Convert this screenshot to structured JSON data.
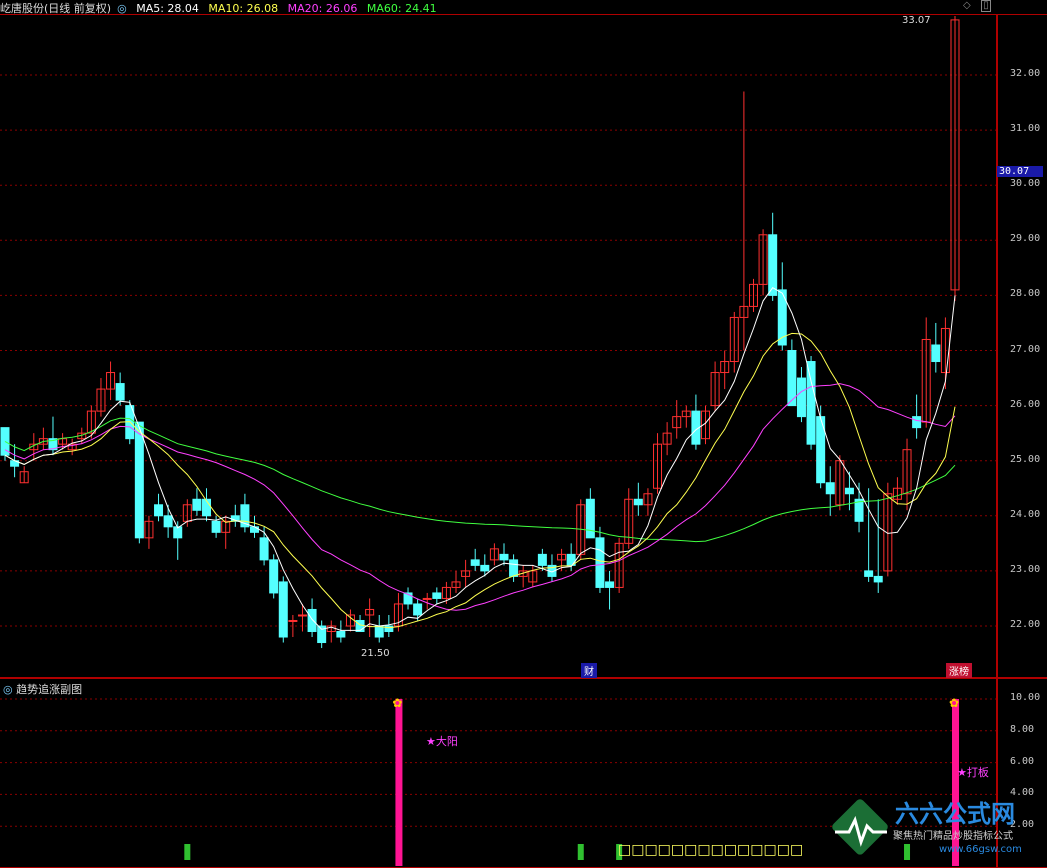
{
  "header": {
    "stock": "屹唐股份(日线 前复权)",
    "ma5": "MA5: 28.04",
    "ma10": "MA10: 26.08",
    "ma20": "MA20: 26.06",
    "ma60": "MA60: 24.41"
  },
  "price_axis": {
    "labels": [
      "32.00",
      "31.00",
      "30.00",
      "29.00",
      "28.00",
      "27.00",
      "26.00",
      "25.00",
      "24.00",
      "23.00",
      "22.00"
    ],
    "current_price": "30.07"
  },
  "annotations": {
    "high": "33.07",
    "low": "21.50",
    "cai_tag": "财",
    "zhangbang_tag": "涨榜"
  },
  "subchart": {
    "title": "趋势追涨副图",
    "axis_labels": [
      "10.00",
      "8.00",
      "6.00",
      "4.00",
      "2.00"
    ],
    "signal1": "★大阳",
    "signal2": "★打板",
    "bottom_squares": "□□□□□□□□□□□□□□"
  },
  "watermark": {
    "brand": "六六公式网",
    "slogan": "聚焦热门精品炒股指标公式",
    "url": "www.66gsw.com"
  },
  "colors": {
    "up": "#ff3030",
    "down": "#54ffff",
    "ma5": "#ffffff",
    "ma10": "#ffff50",
    "ma20": "#ff40ff",
    "ma60": "#40ff40",
    "signal_bar": "#ff1493",
    "grid": "#8b0000"
  },
  "chart_data": [
    {
      "type": "candlestick",
      "title": "屹唐股份(日线 前复权)",
      "ylim": [
        21.3,
        33.3
      ],
      "series": [
        {
          "name": "MA5",
          "value_last": 28.04
        },
        {
          "name": "MA10",
          "value_last": 26.08
        },
        {
          "name": "MA20",
          "value_last": 26.06
        },
        {
          "name": "MA60",
          "value_last": 24.41
        }
      ],
      "candles_ohlc": [
        [
          25.6,
          25.6,
          25.0,
          25.1
        ],
        [
          25.0,
          25.3,
          24.7,
          24.9
        ],
        [
          24.6,
          24.9,
          24.6,
          24.8
        ],
        [
          25.2,
          25.5,
          25.0,
          25.3
        ],
        [
          25.3,
          25.6,
          25.2,
          25.4
        ],
        [
          25.4,
          25.8,
          25.1,
          25.2
        ],
        [
          25.3,
          25.5,
          25.2,
          25.4
        ],
        [
          25.2,
          25.4,
          25.1,
          25.3
        ],
        [
          25.4,
          25.6,
          25.3,
          25.5
        ],
        [
          25.5,
          26.0,
          25.4,
          25.9
        ],
        [
          25.9,
          26.5,
          25.8,
          26.3
        ],
        [
          26.3,
          26.8,
          26.1,
          26.6
        ],
        [
          26.4,
          26.6,
          26.0,
          26.1
        ],
        [
          26.0,
          26.1,
          25.3,
          25.4
        ],
        [
          25.7,
          25.7,
          23.5,
          23.6
        ],
        [
          23.6,
          24.0,
          23.4,
          23.9
        ],
        [
          24.2,
          24.4,
          23.9,
          24.0
        ],
        [
          24.0,
          24.2,
          23.6,
          23.8
        ],
        [
          23.8,
          23.9,
          23.2,
          23.6
        ],
        [
          23.9,
          24.3,
          23.8,
          24.2
        ],
        [
          24.3,
          24.5,
          24.0,
          24.1
        ],
        [
          24.3,
          24.5,
          23.9,
          24.0
        ],
        [
          23.9,
          24.0,
          23.6,
          23.7
        ],
        [
          23.7,
          24.0,
          23.4,
          23.9
        ],
        [
          24.0,
          24.2,
          23.8,
          23.9
        ],
        [
          24.2,
          24.4,
          23.7,
          23.8
        ],
        [
          23.8,
          24.0,
          23.6,
          23.7
        ],
        [
          23.6,
          23.8,
          23.1,
          23.2
        ],
        [
          23.2,
          23.3,
          22.5,
          22.6
        ],
        [
          22.8,
          22.9,
          21.7,
          21.8
        ],
        [
          22.1,
          22.2,
          21.8,
          22.1
        ],
        [
          22.2,
          22.4,
          21.9,
          22.2
        ],
        [
          22.3,
          22.5,
          21.8,
          21.9
        ],
        [
          22.0,
          22.1,
          21.6,
          21.7
        ],
        [
          21.9,
          22.1,
          21.7,
          22.0
        ],
        [
          21.9,
          22.1,
          21.7,
          21.8
        ],
        [
          22.0,
          22.3,
          21.9,
          22.2
        ],
        [
          22.1,
          22.2,
          21.9,
          21.9
        ],
        [
          22.2,
          22.5,
          21.8,
          22.3
        ],
        [
          22.0,
          22.2,
          21.7,
          21.8
        ],
        [
          22.0,
          22.2,
          21.8,
          21.9
        ],
        [
          22.0,
          22.6,
          21.9,
          22.4
        ],
        [
          22.6,
          22.7,
          22.3,
          22.4
        ],
        [
          22.4,
          22.5,
          22.1,
          22.2
        ],
        [
          22.5,
          22.6,
          22.3,
          22.5
        ],
        [
          22.6,
          22.7,
          22.4,
          22.5
        ],
        [
          22.5,
          22.8,
          22.4,
          22.7
        ],
        [
          22.7,
          23.0,
          22.6,
          22.8
        ],
        [
          22.9,
          23.2,
          22.7,
          23.0
        ],
        [
          23.2,
          23.4,
          23.0,
          23.1
        ],
        [
          23.1,
          23.3,
          22.9,
          23.0
        ],
        [
          23.2,
          23.5,
          23.1,
          23.4
        ],
        [
          23.3,
          23.5,
          23.1,
          23.2
        ],
        [
          23.2,
          23.3,
          22.8,
          22.9
        ],
        [
          22.9,
          23.1,
          22.7,
          23.0
        ],
        [
          22.8,
          23.1,
          22.7,
          23.0
        ],
        [
          23.3,
          23.4,
          23.0,
          23.1
        ],
        [
          23.1,
          23.3,
          22.8,
          22.9
        ],
        [
          23.2,
          23.4,
          23.0,
          23.3
        ],
        [
          23.3,
          23.5,
          23.0,
          23.1
        ],
        [
          23.3,
          24.3,
          23.2,
          24.2
        ],
        [
          24.3,
          24.5,
          23.6,
          23.6
        ],
        [
          23.6,
          23.8,
          22.6,
          22.7
        ],
        [
          22.8,
          23.0,
          22.3,
          22.7
        ],
        [
          22.7,
          23.6,
          22.6,
          23.5
        ],
        [
          23.5,
          24.5,
          23.4,
          24.3
        ],
        [
          24.3,
          24.6,
          24.0,
          24.2
        ],
        [
          24.2,
          24.5,
          24.0,
          24.4
        ],
        [
          24.5,
          25.5,
          24.4,
          25.3
        ],
        [
          25.3,
          25.7,
          25.1,
          25.5
        ],
        [
          25.6,
          26.1,
          25.4,
          25.8
        ],
        [
          25.8,
          26.0,
          25.6,
          25.9
        ],
        [
          25.9,
          26.2,
          25.2,
          25.3
        ],
        [
          25.4,
          26.0,
          25.3,
          25.9
        ],
        [
          26.0,
          26.8,
          25.9,
          26.6
        ],
        [
          26.6,
          27.0,
          26.3,
          26.8
        ],
        [
          26.8,
          27.7,
          26.6,
          27.6
        ],
        [
          27.6,
          31.7,
          27.0,
          27.8
        ],
        [
          27.8,
          28.3,
          27.7,
          28.2
        ],
        [
          28.2,
          29.2,
          28.0,
          29.1
        ],
        [
          29.1,
          29.5,
          27.9,
          28.0
        ],
        [
          28.1,
          28.6,
          27.0,
          27.1
        ],
        [
          27.0,
          27.2,
          26.0,
          26.0
        ],
        [
          26.5,
          26.7,
          25.7,
          25.8
        ],
        [
          26.8,
          26.9,
          25.2,
          25.3
        ],
        [
          25.8,
          26.0,
          24.5,
          24.6
        ],
        [
          24.6,
          24.9,
          24.0,
          24.4
        ],
        [
          24.2,
          25.1,
          24.1,
          25.0
        ],
        [
          24.5,
          24.8,
          24.1,
          24.4
        ],
        [
          24.3,
          24.6,
          23.7,
          23.9
        ],
        [
          23.0,
          24.5,
          22.8,
          22.9
        ],
        [
          22.9,
          24.3,
          22.6,
          22.8
        ],
        [
          23.0,
          24.6,
          22.9,
          24.4
        ],
        [
          24.3,
          24.7,
          24.2,
          24.5
        ],
        [
          24.4,
          25.4,
          24.1,
          25.2
        ],
        [
          25.8,
          26.2,
          25.4,
          25.6
        ],
        [
          25.7,
          27.6,
          25.6,
          27.2
        ],
        [
          27.1,
          27.5,
          26.6,
          26.8
        ],
        [
          26.6,
          27.6,
          26.3,
          27.4
        ],
        [
          28.1,
          33.07,
          27.9,
          33.0
        ]
      ]
    }
  ]
}
